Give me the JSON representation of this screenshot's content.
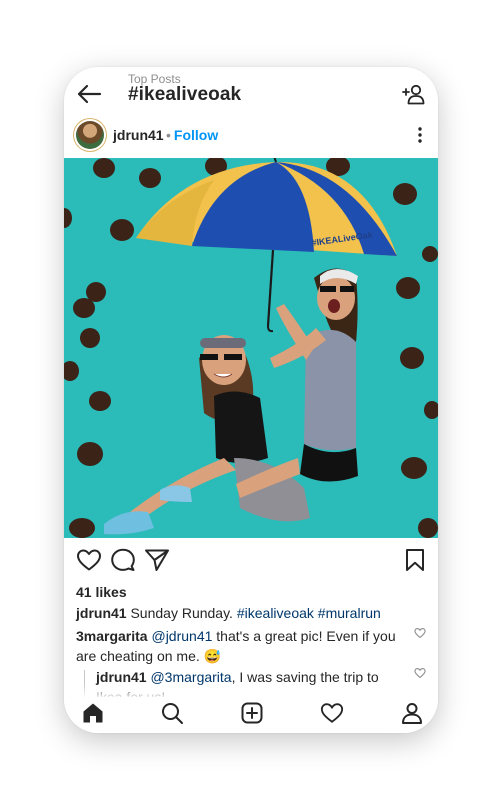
{
  "header": {
    "subtitle": "Top Posts",
    "title": "#ikealiveoak",
    "back_icon": "arrow-left-icon",
    "follow_hashtag_icon": "add-person-icon"
  },
  "post": {
    "username": "jdrun41",
    "follow_label": "Follow",
    "separator": "•",
    "more_icon": "three-dots-vertical-icon",
    "photo": {
      "umbrella_text": "#IKEALiveOak",
      "colors": {
        "wall": "#2fc2bf",
        "dots": "#3b2317",
        "umbrella_blue": "#1e4fb0",
        "umbrella_yellow": "#f2c24c"
      }
    },
    "actions": {
      "like_icon": "heart-icon",
      "comment_icon": "comment-icon",
      "share_icon": "paper-plane-icon",
      "save_icon": "bookmark-icon"
    },
    "likes": "41 likes",
    "caption": {
      "username": "jdrun41",
      "text": "Sunday Runday.",
      "tags": "#ikealiveoak #muralrun"
    },
    "comments": [
      {
        "username": "3margarita",
        "mention": "@jdrun41",
        "text": "that's a great pic! Even if you are cheating on me.",
        "emoji": "😅"
      }
    ],
    "reply": {
      "username": "jdrun41",
      "mention": "@3margarita",
      "text": ", I was saving the trip to Ikea for us!"
    }
  },
  "nav": {
    "items": [
      "home-icon",
      "search-icon",
      "new-post-icon",
      "activity-heart-icon",
      "profile-icon"
    ]
  },
  "colors": {
    "link": "#0095f6",
    "hashtag": "#00376b",
    "text": "#262626",
    "muted": "#8e8e8e"
  }
}
